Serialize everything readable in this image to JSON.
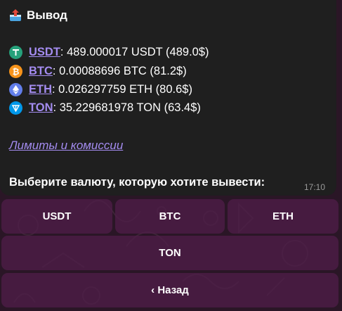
{
  "message": {
    "title": "Вывод",
    "title_icon": "outbox-tray-icon",
    "balances": [
      {
        "icon": "tether-icon",
        "color": "#26a17b",
        "ticker": "USDT",
        "amount": ": 489.000017 USDT (489.0$)"
      },
      {
        "icon": "bitcoin-icon",
        "color": "#f7931a",
        "ticker": "BTC",
        "amount": ": 0.00088696 BTC (81.2$)"
      },
      {
        "icon": "ethereum-icon",
        "color": "#627eea",
        "ticker": "ETH",
        "amount": ": 0.026297759 ETH (80.6$)"
      },
      {
        "icon": "toncoin-icon",
        "color": "#0098ea",
        "ticker": "TON",
        "amount": ": 35.229681978 TON (63.4$)"
      }
    ],
    "limits_link": "Лимиты и комиссии",
    "prompt": "Выберите валюту, которую хотите вывести:",
    "time": "17:10"
  },
  "keyboard": {
    "usdt": "USDT",
    "btc": "BTC",
    "eth": "ETH",
    "ton": "TON",
    "back": "‹ Назад"
  },
  "colors": {
    "link": "#a48cf0",
    "bubble": "#1f1f1f",
    "button": "#4e1e48"
  }
}
